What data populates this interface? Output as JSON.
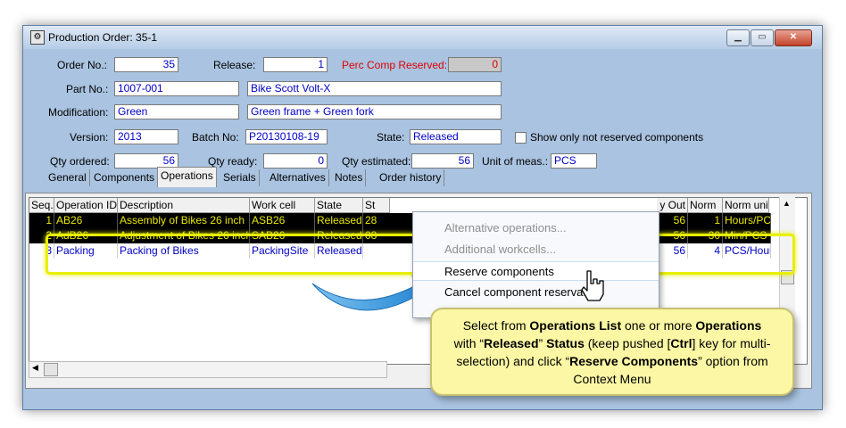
{
  "window": {
    "title": "Production Order: 35-1",
    "min_icon": "minimize-icon",
    "max_icon": "maximize-icon",
    "close_icon": "close-icon"
  },
  "form": {
    "order_no_label": "Order No.:",
    "order_no": "35",
    "release_label": "Release:",
    "release": "1",
    "perc_label": "Perc Comp Reserved:",
    "perc": "0",
    "part_no_label": "Part No.:",
    "part_no": "1007-001",
    "part_desc": "Bike Scott Volt-X",
    "modification_label": "Modification:",
    "modification": "Green",
    "modification_desc": "Green frame + Green fork",
    "version_label": "Version:",
    "version": "2013",
    "batch_label": "Batch No:",
    "batch": "P20130108-19",
    "state_label": "State:",
    "state": "Released",
    "only_not_reserved_label": "Show only not reserved components",
    "qty_ordered_label": "Qty ordered:",
    "qty_ordered": "56",
    "qty_ready_label": "Qty ready:",
    "qty_ready": "0",
    "qty_estimated_label": "Qty estimated:",
    "qty_estimated": "56",
    "uom_label": "Unit of meas.:",
    "uom": "PCS"
  },
  "tabs": [
    "General",
    "Components",
    "Operations",
    "Serials",
    "Alternatives",
    "Notes",
    "Order history"
  ],
  "grid": {
    "headers": [
      "Seq.",
      "Operation ID",
      "Description",
      "Work cell",
      "State",
      "St",
      "y Out",
      "Norm",
      "Norm unit"
    ],
    "rows": [
      {
        "seq": "1",
        "op": "AB26",
        "desc": "Assembly of Bikes 26 inch",
        "cell": "ASB26",
        "state": "Released",
        "st": "28",
        "out": "56",
        "norm": "1",
        "unit": "Hours/PCS"
      },
      {
        "seq": "2",
        "op": "AdB26",
        "desc": "Adjustment of Bikes 26 inch",
        "cell": "SAB26",
        "state": "Released",
        "st": "08",
        "out": "56",
        "norm": "30",
        "unit": "Min/PCS"
      },
      {
        "seq": "3",
        "op": "Packing",
        "desc": "Packing of Bikes",
        "cell": "PackingSite",
        "state": "Released",
        "st": "",
        "out": "56",
        "norm": "4",
        "unit": "PCS/Hour"
      }
    ]
  },
  "context_menu": [
    "Alternative operations...",
    "Additional workcells...",
    "Reserve components",
    "Cancel component reservation"
  ],
  "callout": {
    "t1": "Select from ",
    "b1": "Operations List",
    "t2": " one or more ",
    "b2": "Operations",
    "t3": " with “",
    "b3": "Released",
    "t4": "” ",
    "b4": "Status",
    "t5": " (keep pushed [",
    "b5": "Ctrl",
    "t6": "] key for multi-selection) and click “",
    "b6": "Reserve Components",
    "t7": "” option from Context Menu"
  },
  "colors": {
    "selection_highlight": "#e8f000",
    "callout_bg": "#fbf7a4",
    "field_text": "#0000c8",
    "arrow": "#3a9ee0"
  }
}
